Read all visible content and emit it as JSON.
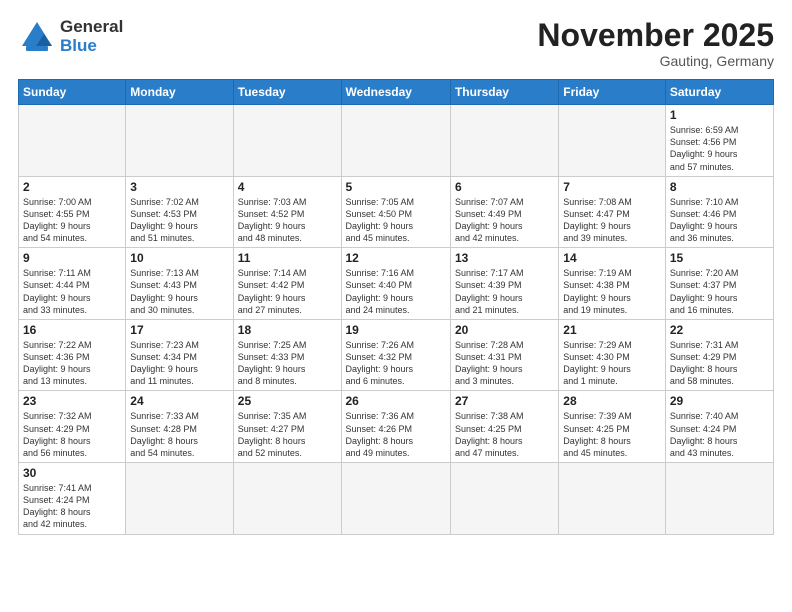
{
  "logo": {
    "general": "General",
    "blue": "Blue"
  },
  "title": "November 2025",
  "subtitle": "Gauting, Germany",
  "days_of_week": [
    "Sunday",
    "Monday",
    "Tuesday",
    "Wednesday",
    "Thursday",
    "Friday",
    "Saturday"
  ],
  "weeks": [
    [
      {
        "day": "",
        "info": ""
      },
      {
        "day": "",
        "info": ""
      },
      {
        "day": "",
        "info": ""
      },
      {
        "day": "",
        "info": ""
      },
      {
        "day": "",
        "info": ""
      },
      {
        "day": "",
        "info": ""
      },
      {
        "day": "1",
        "info": "Sunrise: 6:59 AM\nSunset: 4:56 PM\nDaylight: 9 hours\nand 57 minutes."
      }
    ],
    [
      {
        "day": "2",
        "info": "Sunrise: 7:00 AM\nSunset: 4:55 PM\nDaylight: 9 hours\nand 54 minutes."
      },
      {
        "day": "3",
        "info": "Sunrise: 7:02 AM\nSunset: 4:53 PM\nDaylight: 9 hours\nand 51 minutes."
      },
      {
        "day": "4",
        "info": "Sunrise: 7:03 AM\nSunset: 4:52 PM\nDaylight: 9 hours\nand 48 minutes."
      },
      {
        "day": "5",
        "info": "Sunrise: 7:05 AM\nSunset: 4:50 PM\nDaylight: 9 hours\nand 45 minutes."
      },
      {
        "day": "6",
        "info": "Sunrise: 7:07 AM\nSunset: 4:49 PM\nDaylight: 9 hours\nand 42 minutes."
      },
      {
        "day": "7",
        "info": "Sunrise: 7:08 AM\nSunset: 4:47 PM\nDaylight: 9 hours\nand 39 minutes."
      },
      {
        "day": "8",
        "info": "Sunrise: 7:10 AM\nSunset: 4:46 PM\nDaylight: 9 hours\nand 36 minutes."
      }
    ],
    [
      {
        "day": "9",
        "info": "Sunrise: 7:11 AM\nSunset: 4:44 PM\nDaylight: 9 hours\nand 33 minutes."
      },
      {
        "day": "10",
        "info": "Sunrise: 7:13 AM\nSunset: 4:43 PM\nDaylight: 9 hours\nand 30 minutes."
      },
      {
        "day": "11",
        "info": "Sunrise: 7:14 AM\nSunset: 4:42 PM\nDaylight: 9 hours\nand 27 minutes."
      },
      {
        "day": "12",
        "info": "Sunrise: 7:16 AM\nSunset: 4:40 PM\nDaylight: 9 hours\nand 24 minutes."
      },
      {
        "day": "13",
        "info": "Sunrise: 7:17 AM\nSunset: 4:39 PM\nDaylight: 9 hours\nand 21 minutes."
      },
      {
        "day": "14",
        "info": "Sunrise: 7:19 AM\nSunset: 4:38 PM\nDaylight: 9 hours\nand 19 minutes."
      },
      {
        "day": "15",
        "info": "Sunrise: 7:20 AM\nSunset: 4:37 PM\nDaylight: 9 hours\nand 16 minutes."
      }
    ],
    [
      {
        "day": "16",
        "info": "Sunrise: 7:22 AM\nSunset: 4:36 PM\nDaylight: 9 hours\nand 13 minutes."
      },
      {
        "day": "17",
        "info": "Sunrise: 7:23 AM\nSunset: 4:34 PM\nDaylight: 9 hours\nand 11 minutes."
      },
      {
        "day": "18",
        "info": "Sunrise: 7:25 AM\nSunset: 4:33 PM\nDaylight: 9 hours\nand 8 minutes."
      },
      {
        "day": "19",
        "info": "Sunrise: 7:26 AM\nSunset: 4:32 PM\nDaylight: 9 hours\nand 6 minutes."
      },
      {
        "day": "20",
        "info": "Sunrise: 7:28 AM\nSunset: 4:31 PM\nDaylight: 9 hours\nand 3 minutes."
      },
      {
        "day": "21",
        "info": "Sunrise: 7:29 AM\nSunset: 4:30 PM\nDaylight: 9 hours\nand 1 minute."
      },
      {
        "day": "22",
        "info": "Sunrise: 7:31 AM\nSunset: 4:29 PM\nDaylight: 8 hours\nand 58 minutes."
      }
    ],
    [
      {
        "day": "23",
        "info": "Sunrise: 7:32 AM\nSunset: 4:29 PM\nDaylight: 8 hours\nand 56 minutes."
      },
      {
        "day": "24",
        "info": "Sunrise: 7:33 AM\nSunset: 4:28 PM\nDaylight: 8 hours\nand 54 minutes."
      },
      {
        "day": "25",
        "info": "Sunrise: 7:35 AM\nSunset: 4:27 PM\nDaylight: 8 hours\nand 52 minutes."
      },
      {
        "day": "26",
        "info": "Sunrise: 7:36 AM\nSunset: 4:26 PM\nDaylight: 8 hours\nand 49 minutes."
      },
      {
        "day": "27",
        "info": "Sunrise: 7:38 AM\nSunset: 4:25 PM\nDaylight: 8 hours\nand 47 minutes."
      },
      {
        "day": "28",
        "info": "Sunrise: 7:39 AM\nSunset: 4:25 PM\nDaylight: 8 hours\nand 45 minutes."
      },
      {
        "day": "29",
        "info": "Sunrise: 7:40 AM\nSunset: 4:24 PM\nDaylight: 8 hours\nand 43 minutes."
      }
    ],
    [
      {
        "day": "30",
        "info": "Sunrise: 7:41 AM\nSunset: 4:24 PM\nDaylight: 8 hours\nand 42 minutes."
      },
      {
        "day": "",
        "info": ""
      },
      {
        "day": "",
        "info": ""
      },
      {
        "day": "",
        "info": ""
      },
      {
        "day": "",
        "info": ""
      },
      {
        "day": "",
        "info": ""
      },
      {
        "day": "",
        "info": ""
      }
    ]
  ]
}
